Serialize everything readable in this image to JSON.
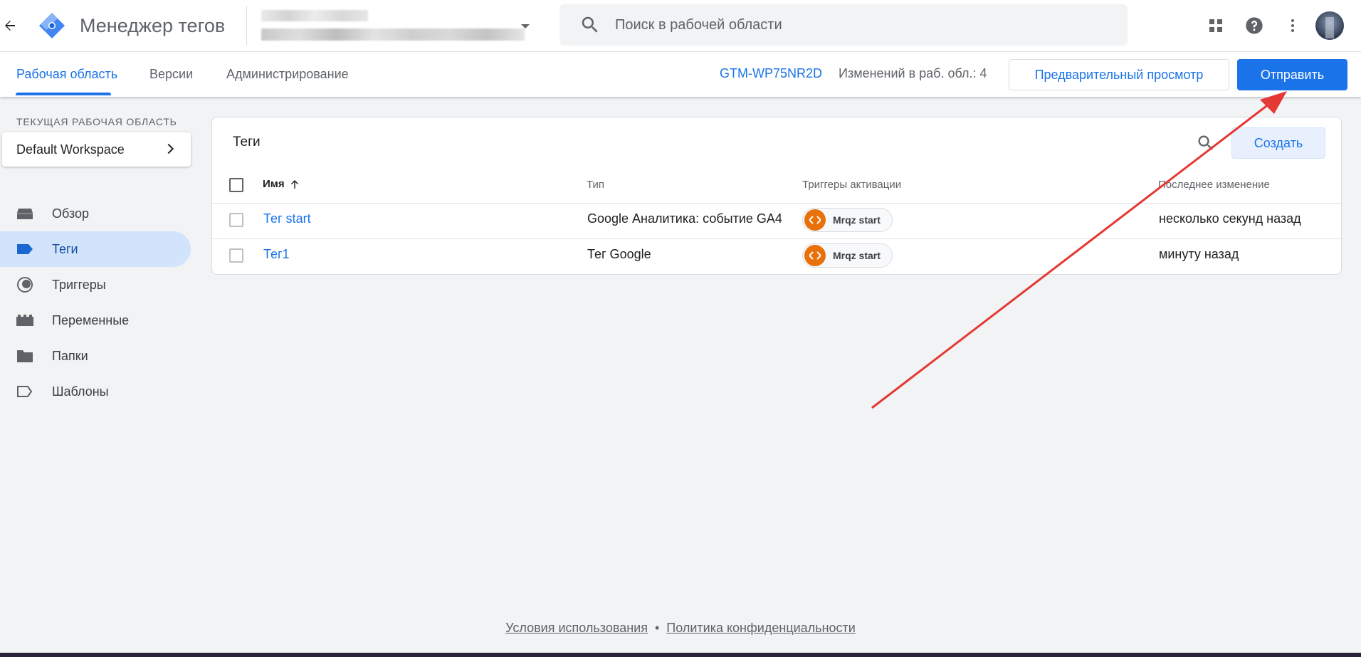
{
  "header": {
    "back_icon": "arrow-back-icon",
    "app_title": "Менеджер тегов",
    "search_placeholder": "Поиск в рабочей области",
    "icons": [
      "apps-grid-icon",
      "help-icon",
      "more-vert-icon"
    ]
  },
  "subnav": {
    "tabs": [
      {
        "label": "Рабочая область",
        "active": true
      },
      {
        "label": "Версии",
        "active": false
      },
      {
        "label": "Администрирование",
        "active": false
      }
    ],
    "container_id": "GTM-WP75NR2D",
    "changes_text": "Изменений в раб. обл.: 4",
    "preview_label": "Предварительный просмотр",
    "submit_label": "Отправить"
  },
  "sidebar": {
    "workspace_caption": "ТЕКУЩАЯ РАБОЧАЯ ОБЛАСТЬ",
    "workspace_name": "Default Workspace",
    "items": [
      {
        "label": "Обзор",
        "icon": "overview-icon",
        "active": false
      },
      {
        "label": "Теги",
        "icon": "tag-icon",
        "active": true
      },
      {
        "label": "Триггеры",
        "icon": "trigger-icon",
        "active": false
      },
      {
        "label": "Переменные",
        "icon": "variables-icon",
        "active": false
      },
      {
        "label": "Папки",
        "icon": "folder-icon",
        "active": false
      },
      {
        "label": "Шаблоны",
        "icon": "template-icon",
        "active": false
      }
    ]
  },
  "tags_card": {
    "title": "Теги",
    "create_label": "Создать",
    "columns": [
      "Имя",
      "Тип",
      "Триггеры активации",
      "Последнее изменение"
    ],
    "rows": [
      {
        "name": "Тег start",
        "type": "Google Аналитика: событие GA4",
        "trigger": "Mrqz start",
        "modified": "несколько секунд назад"
      },
      {
        "name": "Тег1",
        "type": "Тег Google",
        "trigger": "Mrqz start",
        "modified": "минуту назад"
      }
    ]
  },
  "footer": {
    "terms": "Условия использования",
    "separator": "•",
    "privacy": "Политика конфиденциальности"
  },
  "colors": {
    "accent": "#1a73e8",
    "trigger_chip": "#e8710a",
    "annotation_arrow": "#e53935"
  }
}
